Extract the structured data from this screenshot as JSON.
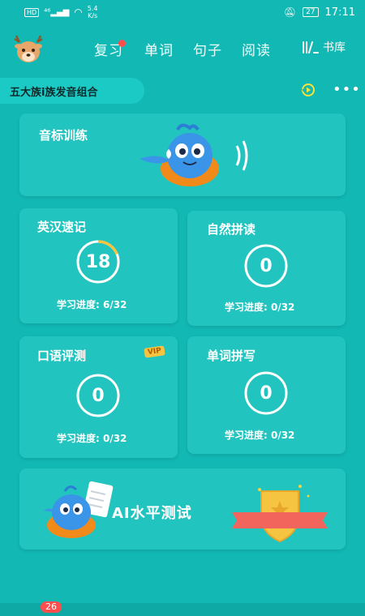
{
  "status_bar": {
    "hd": "HD",
    "signal": "⁴⁶",
    "speed_top": "5.4",
    "speed_bottom": "K/s",
    "battery": "27",
    "time": "17:11"
  },
  "header": {
    "tabs": [
      {
        "label": "复习",
        "active": false,
        "has_dot": true
      },
      {
        "label": "单词",
        "active": true,
        "has_dot": false
      },
      {
        "label": "句子",
        "active": false,
        "has_dot": false
      },
      {
        "label": "阅读",
        "active": false,
        "has_dot": false
      }
    ],
    "library_label": "书库"
  },
  "course": {
    "name": "五大族i族发音组合"
  },
  "cards": {
    "phonetic": {
      "title": "音标训练"
    },
    "vocab": {
      "title": "英汉速记",
      "value": "18",
      "progress_label": "学习进度: 6/32",
      "progress_fraction": 0.1875
    },
    "phonics": {
      "title": "自然拼读",
      "value": "0",
      "progress_label": "学习进度: 0/32",
      "progress_fraction": 0
    },
    "speaking": {
      "title": "口语评测",
      "badge": "VIP",
      "value": "0",
      "progress_label": "学习进度: 0/32",
      "progress_fraction": 0
    },
    "spelling": {
      "title": "单词拼写",
      "value": "0",
      "progress_label": "学习进度: 0/32",
      "progress_fraction": 0
    },
    "ai_test": {
      "title": "AI水平测试"
    }
  },
  "bottom": {
    "badge_count": "26"
  },
  "colors": {
    "background": "#12b8b4",
    "card": "#22c4bf",
    "progress": "#f5c542",
    "badge": "#ff4d4d"
  }
}
